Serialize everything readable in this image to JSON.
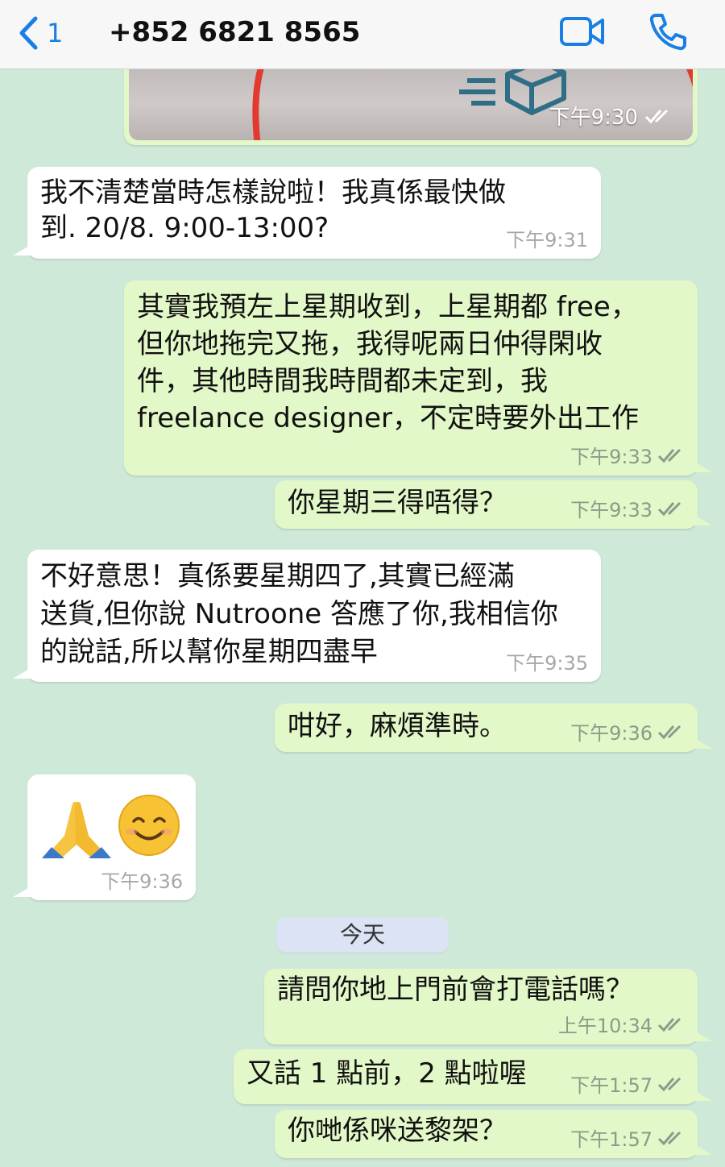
{
  "header": {
    "back_count": "1",
    "contact": "+852 6821 8565",
    "icons": {
      "back": "chevron-left-icon",
      "video": "video-camera-icon",
      "call": "phone-icon"
    },
    "accent_color": "#1a7fe4"
  },
  "chat_background": "#cfe9d9",
  "messages": [
    {
      "dir": "out",
      "type": "image",
      "time": "下午9:30",
      "status": "read"
    },
    {
      "dir": "in",
      "text": "我不清楚當時怎樣說啦！我真係最快做\n到. 20/8. 9:00-13:00?",
      "time": "下午9:31"
    },
    {
      "dir": "out",
      "text": "其實我預左上星期收到，上星期都 free，\n但你地拖完又拖，我得呢兩日仲得閑收\n件，其他時間我時間都未定到，我\nfreelance designer，不定時要外出工作",
      "time": "下午9:33",
      "status": "read"
    },
    {
      "dir": "out",
      "text": "你星期三得唔得？",
      "time": "下午9:33",
      "status": "read"
    },
    {
      "dir": "in",
      "text": "不好意思！真係要星期四了,其實已經滿\n送貨,但你說 Nutroone 答應了你,我相信你\n的說話,所以幫你星期四盡早",
      "time": "下午9:35"
    },
    {
      "dir": "out",
      "text": "咁好，麻煩準時。",
      "time": "下午9:36",
      "status": "read"
    },
    {
      "dir": "in",
      "type": "emoji",
      "emojis": [
        "folded-hands-emoji",
        "smiling-face-emoji"
      ],
      "time": "下午9:36"
    },
    {
      "dir": "out",
      "text": "請問你地上門前會打電話嗎？",
      "time": "上午10:34",
      "status": "read"
    },
    {
      "dir": "out",
      "text": "又話 1 點前，2 點啦喔",
      "time": "下午1:57",
      "status": "read"
    },
    {
      "dir": "out",
      "text": "你哋係咪送黎架？",
      "time": "下午1:57",
      "status": "read"
    }
  ],
  "day_separator": "今天"
}
